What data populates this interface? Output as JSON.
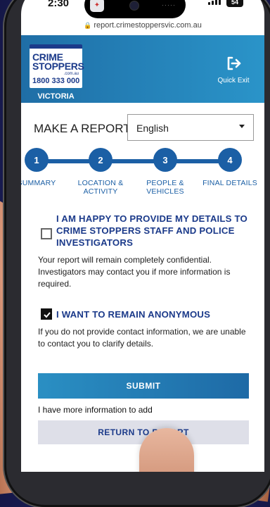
{
  "status_bar": {
    "time": "2:30",
    "battery": "54",
    "url": "report.crimestoppersvic.com.au"
  },
  "header": {
    "logo": {
      "line1": "CRIME",
      "line2": "STOPPERS",
      "domain": ".com.au",
      "phone": "1800 333 000",
      "state": "VICTORIA"
    },
    "quick_exit_label": "Quick Exit",
    "background": "#2a94c9"
  },
  "report": {
    "title": "MAKE A REPORT",
    "language": "English"
  },
  "steps": [
    {
      "number": "1",
      "label": "SUMMARY"
    },
    {
      "number": "2",
      "label": "LOCATION & ACTIVITY"
    },
    {
      "number": "3",
      "label": "PEOPLE & VEHICLES"
    },
    {
      "number": "4",
      "label": "FINAL DETAILS"
    }
  ],
  "options": {
    "provide_details": {
      "title": "I AM HAPPY TO PROVIDE MY DETAILS TO CRIME STOPPERS STAFF AND POLICE INVESTIGATORS",
      "checked": false,
      "description": "Your report will remain completely confidential. Investigators may contact you if more information is required."
    },
    "anonymous": {
      "title": "I WANT TO REMAIN ANONYMOUS",
      "checked": true,
      "description": "If you do not provide contact information, we are unable to contact you to clarify details."
    }
  },
  "actions": {
    "submit_label": "SUBMIT",
    "more_info_text": "I have more information to add",
    "return_label": "RETURN TO REPORT"
  },
  "colors": {
    "primary": "#1b5fa5",
    "brand": "#1b3a8a",
    "accent": "#2a8fc3"
  }
}
